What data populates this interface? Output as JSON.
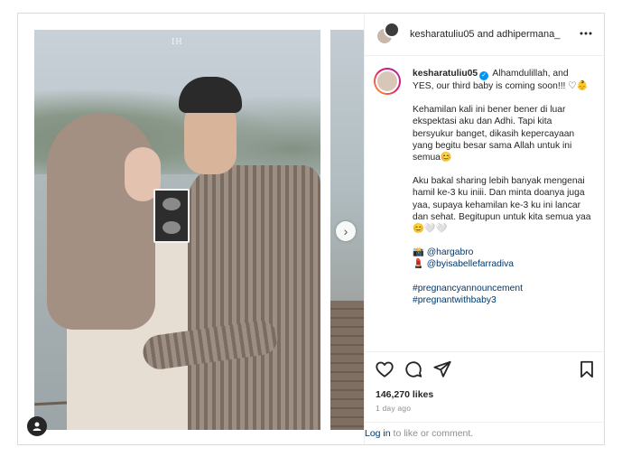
{
  "header": {
    "users_text": "kesharatuliu05 and adhipermana_",
    "more_icon": "more-horizontal-icon"
  },
  "caption": {
    "username": "kesharatuliu05",
    "line1": "Alhamdulillah, and YES, our third baby is coming soon!!! ♡👶",
    "para2": "Kehamilan kali ini bener bener di luar ekspektasi aku dan Adhi. Tapi kita bersyukur banget, dikasih kepercayaan yang begitu besar sama Allah untuk ini semua😊",
    "para3": "Aku bakal sharing lebih banyak mengenai hamil ke-3 ku iniii. Dan minta doanya juga yaa, supaya kehamilan ke-3 ku ini lancar dan sehat. Begitupun untuk kita semua yaa😊🤍🤍",
    "credit1_emoji": "📸",
    "credit1": "@hargabro",
    "credit2_emoji": "💄",
    "credit2": "@byisabellefarradiva",
    "hashtag1": "#pregnancyannouncement",
    "hashtag2": "#pregnantwithbaby3"
  },
  "photo": {
    "watermark": "IH"
  },
  "stats": {
    "likes": "146,270 likes",
    "time_ago": "1 day ago"
  },
  "footer": {
    "login_link": "Log in",
    "login_rest": " to like or comment."
  },
  "colors": {
    "link": "#00376b",
    "verified": "#0095f6",
    "border": "#dbdbdb"
  }
}
